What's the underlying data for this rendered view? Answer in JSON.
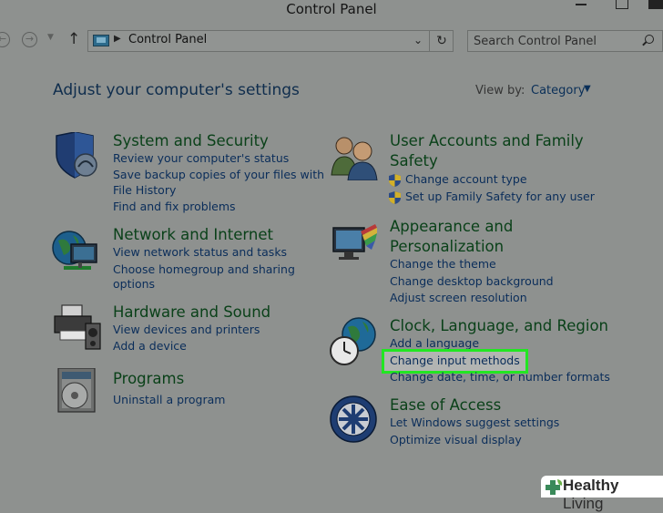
{
  "window": {
    "title": "Control Panel"
  },
  "nav": {
    "address_path": "Control Panel",
    "search_placeholder": "Search Control Panel"
  },
  "header": {
    "heading": "Adjust your computer's settings",
    "view_by_label": "View by:",
    "view_by_value": "Category"
  },
  "categories": {
    "system_security": {
      "title": "System and Security",
      "links": [
        "Review your computer's status",
        "Save backup copies of your files with",
        "File History",
        "Find and fix problems"
      ]
    },
    "network_internet": {
      "title": "Network and Internet",
      "links": [
        "View network status and tasks",
        "Choose homegroup and sharing",
        "options"
      ]
    },
    "hardware_sound": {
      "title": "Hardware and Sound",
      "links": [
        "View devices and printers",
        "Add a device"
      ]
    },
    "programs": {
      "title": "Programs",
      "links": [
        "Uninstall a program"
      ]
    },
    "user_accounts": {
      "title_line1": "User Accounts and Family",
      "title_line2": "Safety",
      "links": [
        "Change account type",
        "Set up Family Safety for any user"
      ]
    },
    "appearance": {
      "title_line1": "Appearance and",
      "title_line2": "Personalization",
      "links": [
        "Change the theme",
        "Change desktop background",
        "Adjust screen resolution"
      ]
    },
    "clock_language": {
      "title": "Clock, Language, and Region",
      "links": [
        "Add a language",
        "Change input methods",
        "Change date, time, or number formats"
      ]
    },
    "ease_access": {
      "title": "Ease of Access",
      "links": [
        "Let Windows suggest settings",
        "Optimize visual display"
      ]
    }
  },
  "colors": {
    "overlay_bg": "#8e918f",
    "highlight": "#22e622",
    "link": "#0a2d5a",
    "category_title": "#0a4119"
  },
  "watermark": {
    "text_bold": "Healthy",
    "text_thin": "Living"
  }
}
